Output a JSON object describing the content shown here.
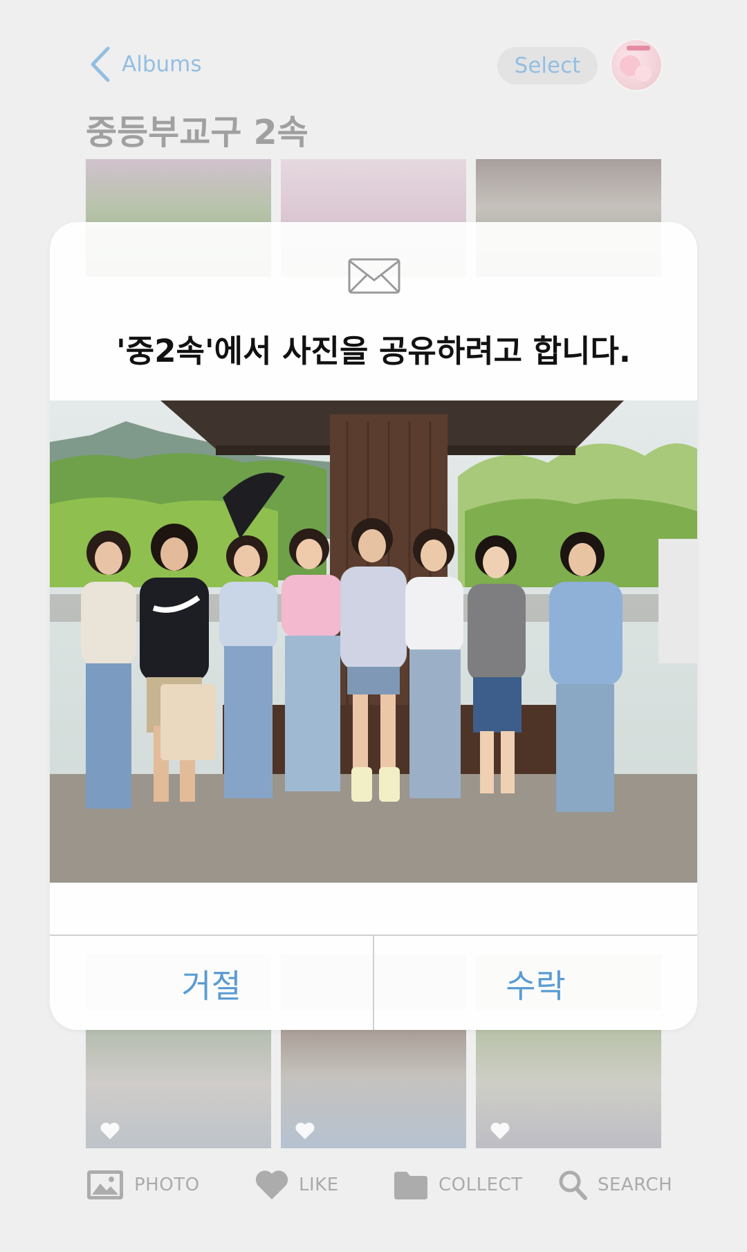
{
  "header": {
    "back_label": "Albums",
    "select_label": "Select",
    "avatar_icon": "album-cover-avatar"
  },
  "album": {
    "title": "중등부교구 2속"
  },
  "dialog": {
    "icon": "envelope-icon",
    "message": "'중2속'에서 사진을 공유하려고 합니다.",
    "reject_label": "거절",
    "accept_label": "수락",
    "accent_color": "#5a9bd3"
  },
  "tab_bar": {
    "items": [
      {
        "label": "PHOTO",
        "icon": "photo-icon"
      },
      {
        "label": "LIKE",
        "icon": "heart-icon"
      },
      {
        "label": "COLLECT",
        "icon": "folder-icon"
      },
      {
        "label": "SEARCH",
        "icon": "search-icon"
      }
    ]
  }
}
